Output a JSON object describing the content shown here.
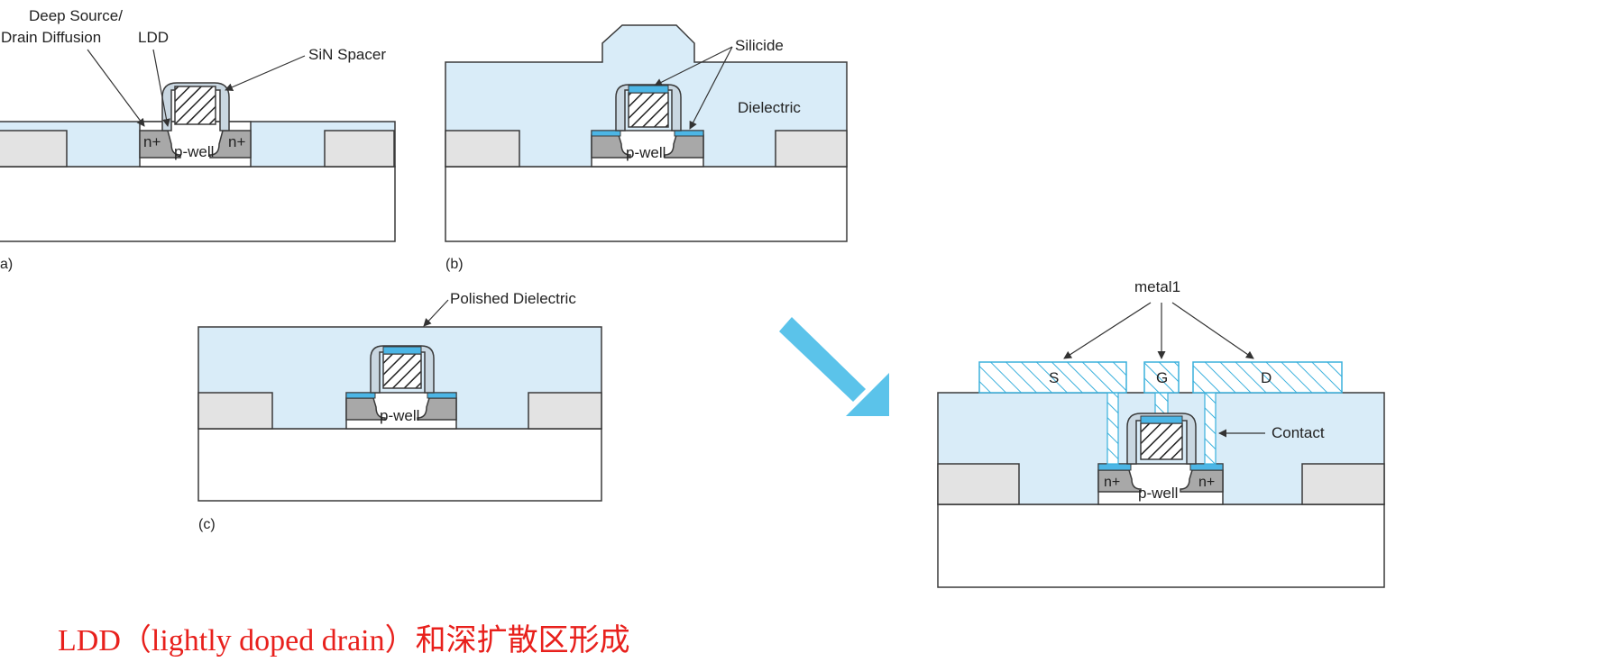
{
  "colors": {
    "dielectric": "#d9ecf8",
    "gray_oxide": "#e3e3e3",
    "diffusion": "#a8a8a8",
    "silicide": "#4cb6e6",
    "metal": "#3ab0dc",
    "arrow": "#5bc3ea",
    "outline": "#3a3a3a",
    "red": "#e8201c"
  },
  "panel_a": {
    "label_deep": "Deep Source/",
    "label_drain": "Drain Diffusion",
    "label_ldd": "LDD",
    "label_spacer": "SiN Spacer",
    "n_left": "n+",
    "n_right": "n+",
    "pwell": "p-well",
    "caption": "a)"
  },
  "panel_b": {
    "label_silicide": "Silicide",
    "label_dielectric": "Dielectric",
    "pwell": "p-well",
    "caption": "(b)"
  },
  "panel_c": {
    "label_polished": "Polished Dielectric",
    "pwell": "p-well",
    "caption": "(c)"
  },
  "panel_d": {
    "label_metal1": "metal1",
    "label_s": "S",
    "label_g": "G",
    "label_d": "D",
    "label_contact": "Contact",
    "n_left": "n+",
    "n_right": "n+",
    "pwell": "p-well"
  },
  "bottom_text": "LDD（lightly doped drain）和深扩散区形成"
}
